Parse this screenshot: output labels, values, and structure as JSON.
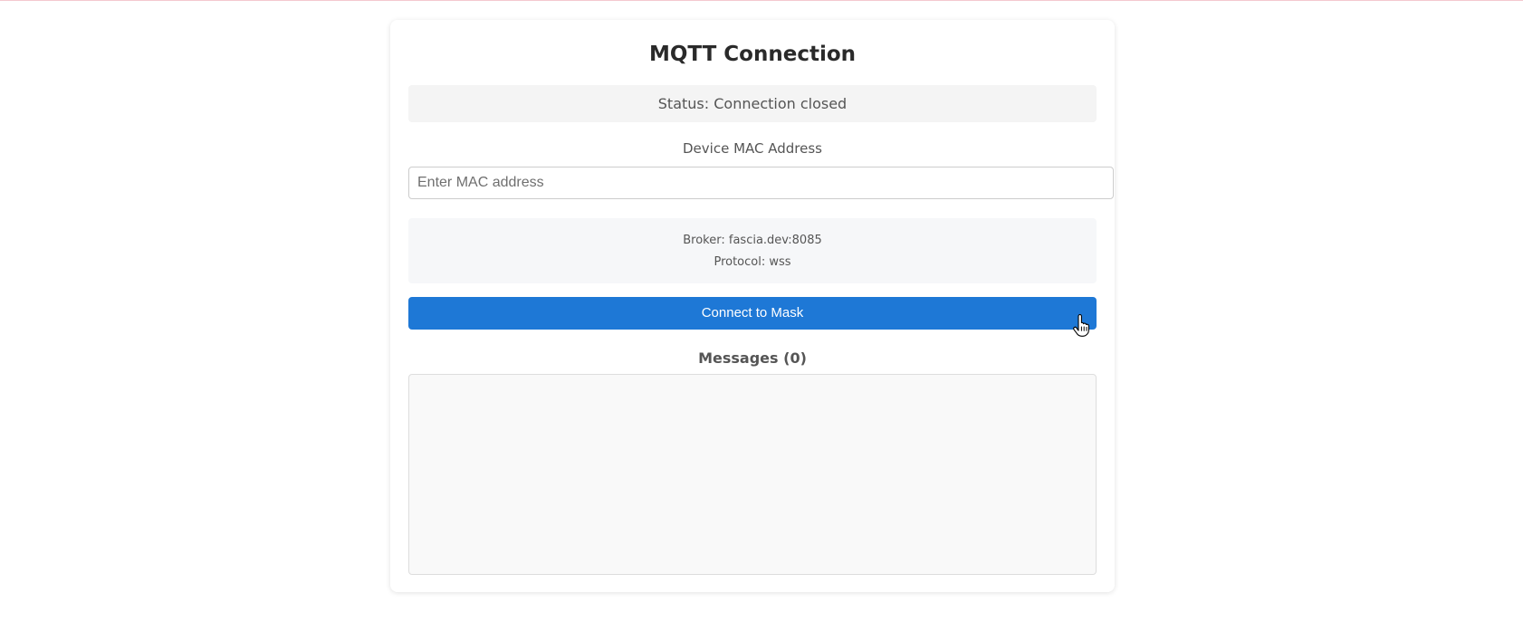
{
  "title": "MQTT Connection",
  "status_text": "Status: Connection closed",
  "device": {
    "label": "Device MAC Address",
    "placeholder": "Enter MAC address",
    "value": ""
  },
  "broker": {
    "broker_line": "Broker: fascia.dev:8085",
    "protocol_line": "Protocol: wss"
  },
  "connect_button_label": "Connect to Mask",
  "messages": {
    "heading": "Messages (0)",
    "items": []
  },
  "colors": {
    "button": "#1e78d6",
    "status_bg": "#f4f4f4",
    "broker_bg": "#f6f7f9",
    "messages_bg": "#f9f9f9"
  }
}
